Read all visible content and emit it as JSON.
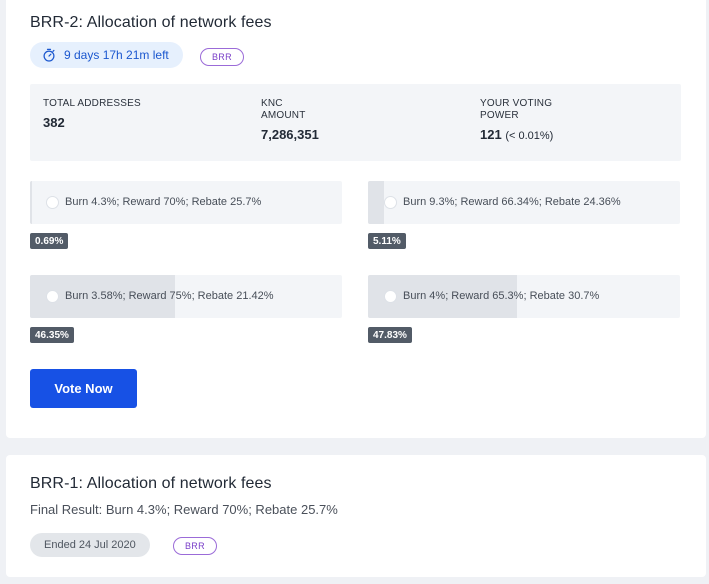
{
  "proposals": [
    {
      "title": "BRR-2: Allocation of network fees",
      "time_left": "9 days 17h 21m left",
      "tag": "BRR",
      "stats": [
        {
          "label": "TOTAL ADDRESSES",
          "value": "382"
        },
        {
          "label": "KNC\nAMOUNT",
          "value": "7,286,351"
        },
        {
          "label": "YOUR VOTING\nPOWER",
          "value": "121",
          "sub": "(< 0.01%)"
        }
      ],
      "options": [
        {
          "label": "Burn 4.3%; Reward 70%; Rebate 25.7%",
          "percent": "0.69%",
          "fraction": 0.0069
        },
        {
          "label": "Burn 9.3%; Reward 66.34%; Rebate 24.36%",
          "percent": "5.11%",
          "fraction": 0.0511
        },
        {
          "label": "Burn 3.58%; Reward 75%; Rebate 21.42%",
          "percent": "46.35%",
          "fraction": 0.4635
        },
        {
          "label": "Burn 4%; Reward 65.3%; Rebate 30.7%",
          "percent": "47.83%",
          "fraction": 0.4783
        }
      ],
      "vote_button": "Vote Now"
    },
    {
      "title": "BRR-1: Allocation of network fees",
      "final_result": "Final Result: Burn 4.3%; Reward 70%; Rebate 25.7%",
      "ended": "Ended 24 Jul 2020",
      "tag": "BRR"
    }
  ],
  "colors": {
    "accent": "#1751e5",
    "timer_bg": "#e6f0fd",
    "tag_border": "#9b6bd8",
    "percent_badge": "#525b67"
  }
}
